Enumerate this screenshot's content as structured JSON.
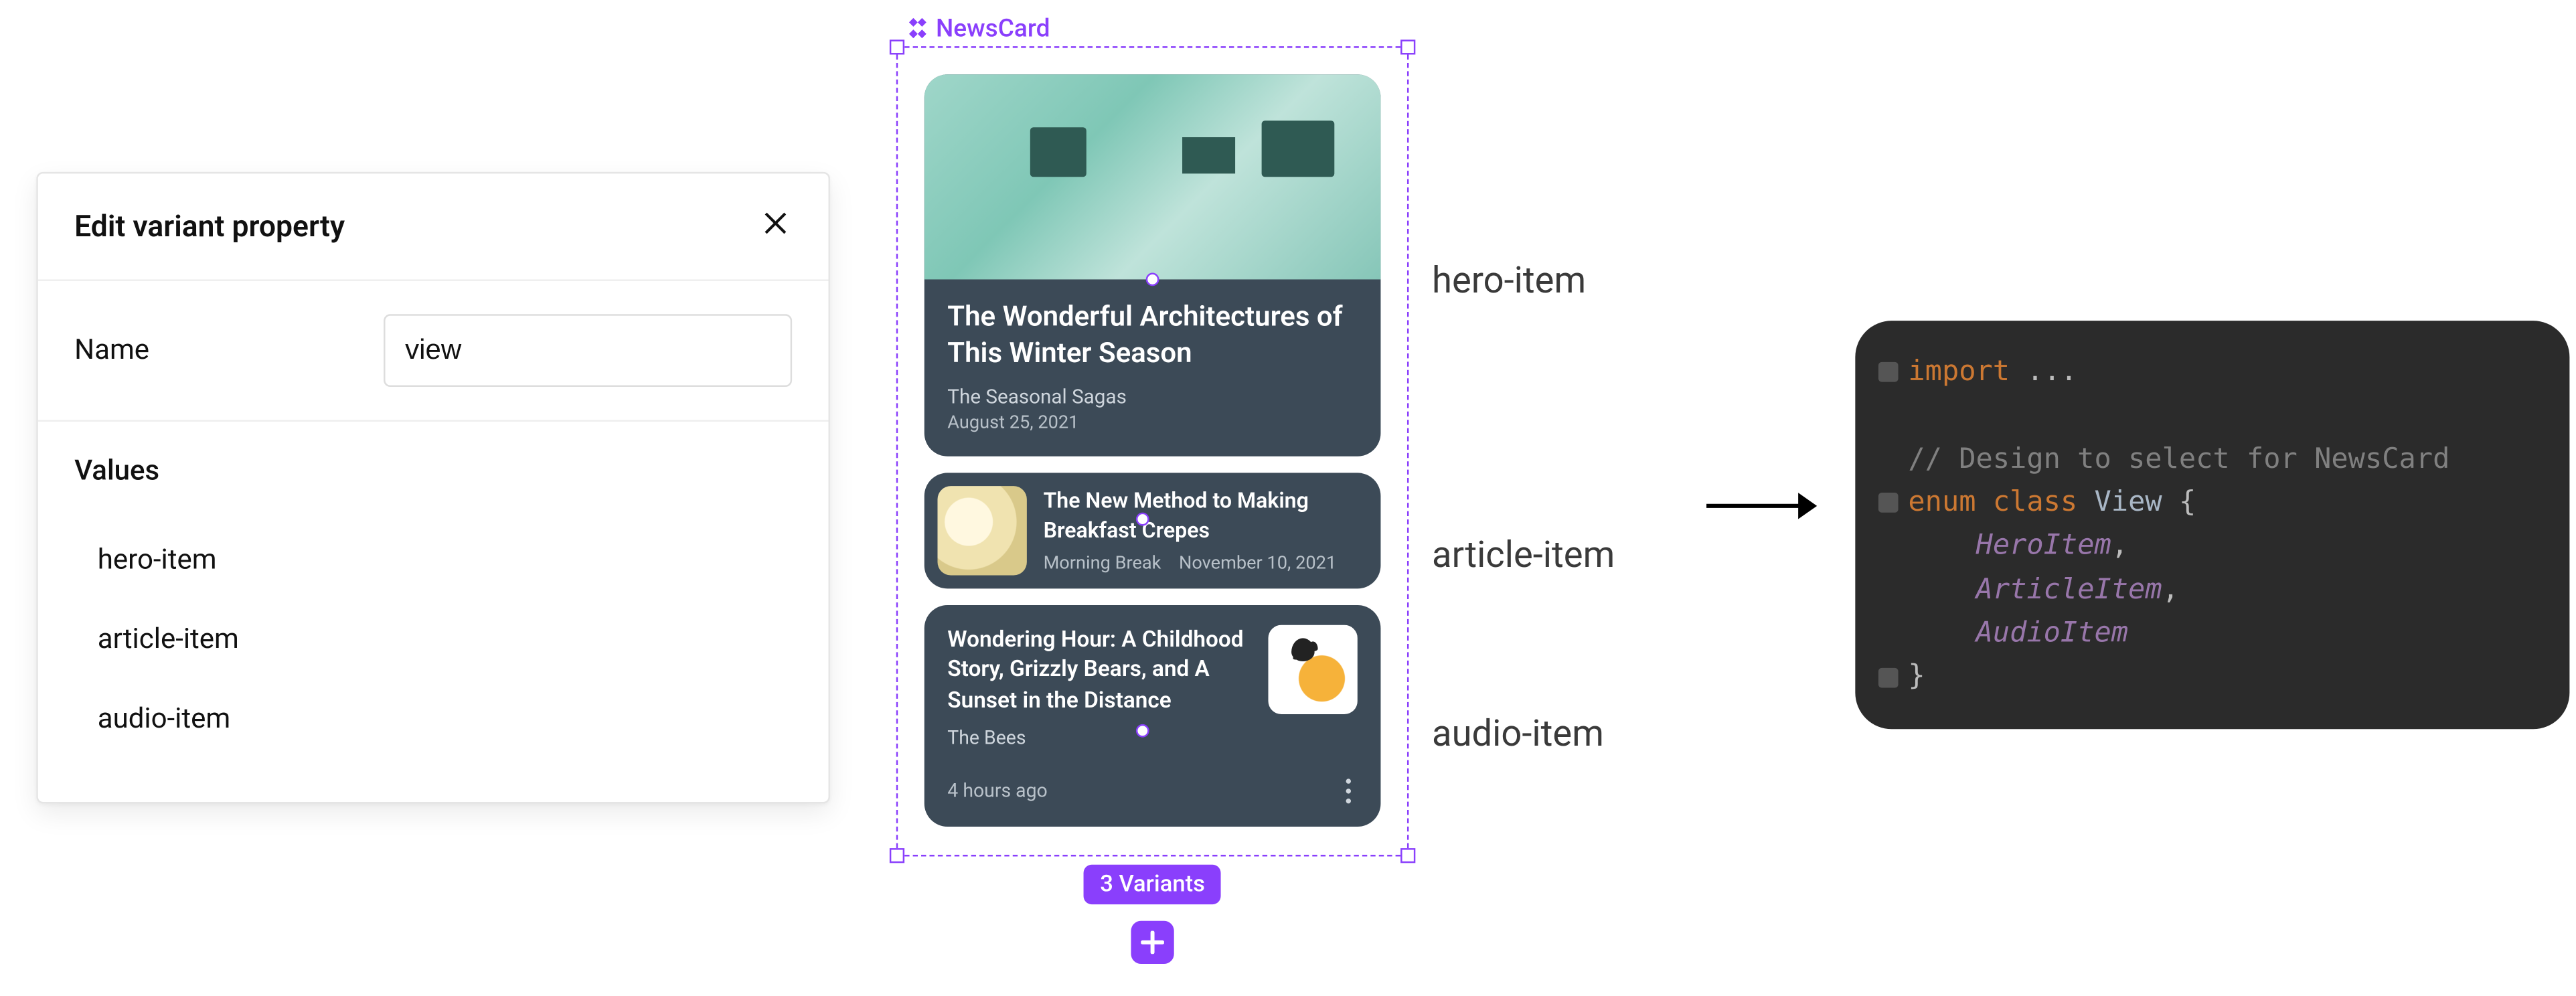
{
  "panel": {
    "title": "Edit variant property",
    "name_label": "Name",
    "name_value": "view",
    "values_heading": "Values",
    "values": [
      "hero-item",
      "article-item",
      "audio-item"
    ]
  },
  "component": {
    "name": "NewsCard",
    "variants_badge": "3 Variants",
    "hero": {
      "title": "The Wonderful Architectures of This Winter Season",
      "source": "The Seasonal Sagas",
      "date": "August 25, 2021"
    },
    "article": {
      "title": "The New Method to Making Breakfast Crepes",
      "source": "Morning Break",
      "date": "November 10, 2021"
    },
    "audio": {
      "title": "Wondering Hour: A Childhood Story, Grizzly Bears, and A Sunset in the Distance",
      "source": "The Bees",
      "time": "4 hours ago"
    }
  },
  "annotations": {
    "hero": "hero-item",
    "article": "article-item",
    "audio": "audio-item"
  },
  "code": {
    "l1a": "import",
    "l1b": " ...",
    "l2": "// Design to select for NewsCard",
    "l3a": "enum",
    "l3b": " class",
    "l3c": " View ",
    "l3d": "{",
    "l4": "HeroItem",
    "l5": "ArticleItem",
    "l6": "AudioItem",
    "l7": "}",
    "comma": ","
  }
}
